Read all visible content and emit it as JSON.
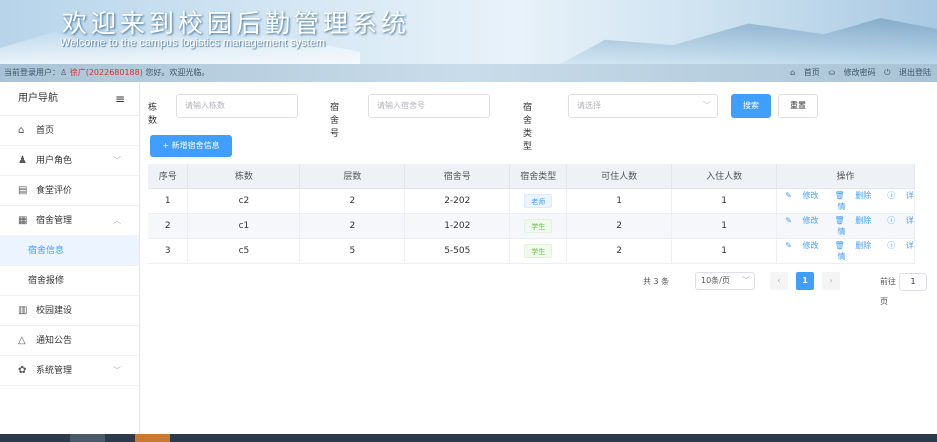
{
  "header": {
    "title_cn": "欢迎来到校园后勤管理系统",
    "title_en": "Welcome to the campus logistics management system"
  },
  "statusbar": {
    "prefix": "当前登录用户：",
    "user": "徐广(2022680188)",
    "greeting": "您好。欢迎光临。",
    "links": [
      "首页",
      "修改密码",
      "退出登陆"
    ]
  },
  "sidebar": {
    "title": "用户导航",
    "items": [
      {
        "label": "首页",
        "icon": "home-icon"
      },
      {
        "label": "用户角色",
        "icon": "user-icon"
      },
      {
        "label": "食堂评价",
        "icon": "document-icon"
      },
      {
        "label": "宿舍管理",
        "icon": "building-icon"
      },
      {
        "label": "宿舍信息"
      },
      {
        "label": "宿舍报修"
      },
      {
        "label": "校园建设",
        "icon": "campus-icon"
      },
      {
        "label": "通知公告",
        "icon": "bell-icon"
      },
      {
        "label": "系统管理",
        "icon": "gear-icon"
      }
    ]
  },
  "filter": {
    "building_label": "栋数",
    "building_placeholder": "请输入栋数",
    "room_label": "宿舍号",
    "room_placeholder": "请输入宿舍号",
    "type_label": "宿舍类型",
    "type_placeholder": "请选择",
    "search": "搜索",
    "reset": "重置"
  },
  "add_button": "+ 新增宿舍信息",
  "table": {
    "headers": [
      "序号",
      "栋数",
      "层数",
      "宿舍号",
      "宿舍类型",
      "可住人数",
      "入住人数",
      "操作"
    ],
    "rows": [
      {
        "no": "1",
        "building": "c2",
        "floor": "2",
        "room": "2-202",
        "type": "老师",
        "capacity": "1",
        "occupied": "1"
      },
      {
        "no": "2",
        "building": "c1",
        "floor": "2",
        "room": "1-202",
        "type": "学生",
        "capacity": "2",
        "occupied": "1"
      },
      {
        "no": "3",
        "building": "c5",
        "floor": "5",
        "room": "5-505",
        "type": "学生",
        "capacity": "2",
        "occupied": "1"
      }
    ],
    "ops": {
      "edit": "修改",
      "delete": "删除",
      "detail": "详情"
    }
  },
  "pagination": {
    "total": "共 3 条",
    "page_size": "10条/页",
    "current": "1",
    "goto_label": "前往",
    "goto_value": "1",
    "page_unit": "页"
  }
}
